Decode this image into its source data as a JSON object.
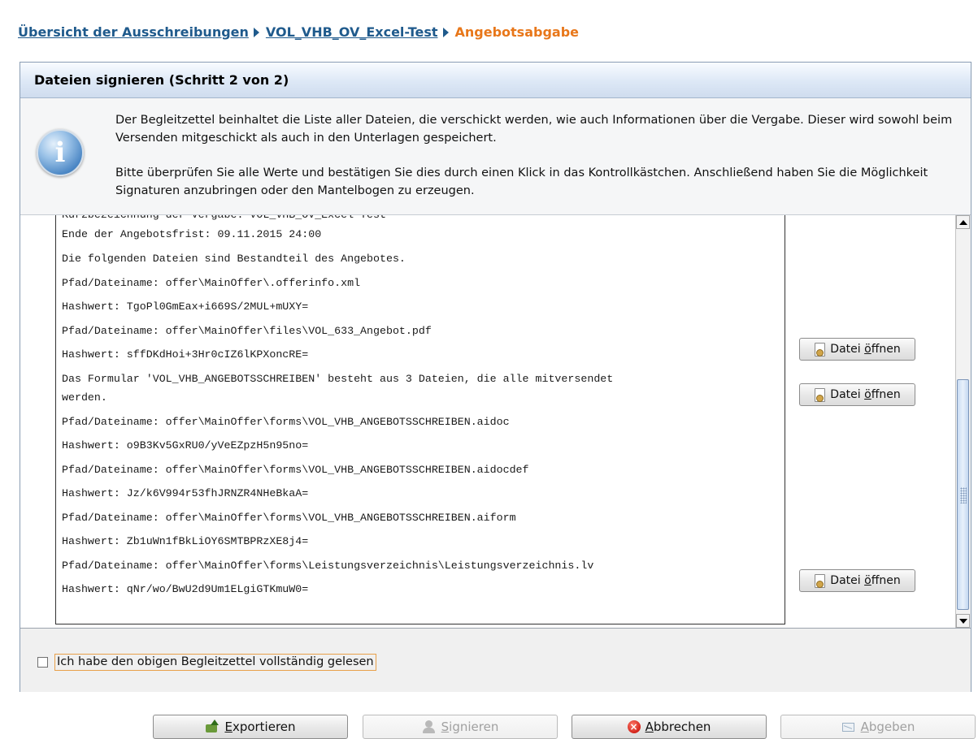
{
  "breadcrumb": {
    "items": [
      "Übersicht der Ausschreibungen",
      "VOL_VHB_OV_Excel-Test"
    ],
    "current": "Angebotsabgabe"
  },
  "panel": {
    "title": "Dateien signieren (Schritt 2 von 2)"
  },
  "info": {
    "icon": "info-icon",
    "paragraph1": "Der Begleitzettel beinhaltet die Liste aller Dateien, die verschickt werden, wie auch Informationen über die Vergabe. Dieser wird sowohl beim Versenden mitgeschickt als auch in den Unterlagen gespeichert.",
    "paragraph2": "Bitte überprüfen Sie alle Werte und bestätigen Sie dies durch einen Klick in das Kontrollkästchen. Anschließend haben Sie die Möglichkeit Signaturen anzubringen oder den Mantelbogen zu erzeugen."
  },
  "document": {
    "lines": [
      "Kurzbezeichnung der Vergabe: VOL_VHB_OV_Excel-Test",
      "Ende der Angebotsfrist: 09.11.2015 24:00",
      "Die folgenden Dateien sind Bestandteil des Angebotes.",
      "Pfad/Dateiname: offer\\MainOffer\\.offerinfo.xml",
      "Hashwert: TgoPl0GmEax+i669S/2MUL+mUXY=",
      "Pfad/Dateiname: offer\\MainOffer\\files\\VOL_633_Angebot.pdf",
      "Hashwert: sffDKdHoi+3Hr0cIZ6lKPXoncRE=",
      "Das Formular 'VOL_VHB_ANGEBOTSSCHREIBEN' besteht aus 3 Dateien, die alle mitversendet",
      "werden.",
      "Pfad/Dateiname: offer\\MainOffer\\forms\\VOL_VHB_ANGEBOTSSCHREIBEN.aidoc",
      "Hashwert: o9B3Kv5GxRU0/yVeEZpzH5n95no=",
      "Pfad/Dateiname: offer\\MainOffer\\forms\\VOL_VHB_ANGEBOTSSCHREIBEN.aidocdef",
      "Hashwert: Jz/k6V994r53fhJRNZR4NHeBkaA=",
      "Pfad/Dateiname: offer\\MainOffer\\forms\\VOL_VHB_ANGEBOTSSCHREIBEN.aiform",
      "Hashwert: Zb1uWn1fBkLiOY6SMTBPRzXE8j4=",
      "Pfad/Dateiname: offer\\MainOffer\\forms\\Leistungsverzeichnis\\Leistungsverzeichnis.lv",
      "Hashwert: qNr/wo/BwU2d9Um1ELgiGTKmuW0="
    ]
  },
  "open_file_buttons": [
    {
      "prefix": "Datei ",
      "accel": "ö",
      "suffix": "ffnen",
      "icon": "file-icon"
    },
    {
      "prefix": "Datei ",
      "accel": "ö",
      "suffix": "ffnen",
      "icon": "file-icon"
    },
    {
      "prefix": "Datei ",
      "accel": "ö",
      "suffix": "ffnen",
      "icon": "file-icon"
    }
  ],
  "confirm": {
    "checked": false,
    "label": "Ich habe den obigen Begleitzettel vollständig gelesen"
  },
  "buttons": {
    "export": {
      "accel": "E",
      "rest": "xportieren",
      "icon": "export-icon"
    },
    "sign": {
      "accel": "S",
      "rest": "ignieren",
      "icon": "sign-icon",
      "enabled": false
    },
    "cancel": {
      "accel": "A",
      "rest": "bbrechen",
      "icon": "cancel-icon"
    },
    "submit": {
      "accel": "A",
      "rest": "bgeben",
      "icon": "submit-icon",
      "enabled": false
    }
  }
}
